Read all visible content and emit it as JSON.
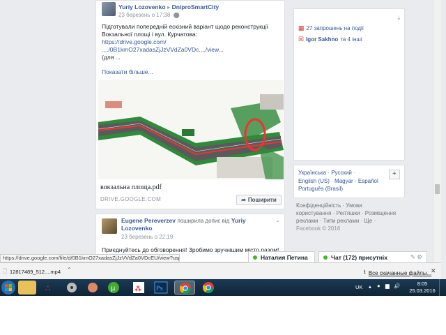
{
  "post1": {
    "author": "Yuriy Lozovenko",
    "arrow": "▸",
    "group": "DniproSmartCity",
    "time": "23 березень о 17:38",
    "globe": "·",
    "text_line1": "Підготували попередній ескізний варіант щодо реконструкції",
    "text_line2": "Вокзальної площі і вул. Курчатова:",
    "link_line1": "https://drive.google.com/",
    "link_line2": "..../0B1kmO27xadasZjJzVVdZa0VDc..../view...",
    "text_line3": "(для ...",
    "show_more": "Показати більше...",
    "attachment_title": "вокзальна площа.pdf",
    "attachment_domain": "DRIVE.GOOGLE.COM",
    "share_label": "Поширити"
  },
  "post2": {
    "author": "Eugene Pereverzev",
    "action": "поширила допис від",
    "author2": "Yuriy",
    "author2b": "Lozovenko",
    "time": "23 березень о 22:19",
    "text": "Приєднуйтесь до обговорення! Зробимо зручнішим місто разом!"
  },
  "right": {
    "invites": "27 запрошень на події",
    "person": "Igor Sakhno",
    "person_suffix": "та 4 інші"
  },
  "languages": {
    "row1": [
      "Українська",
      "Русский"
    ],
    "row2": [
      "English (US)",
      "Magyar",
      "Español"
    ],
    "row3": [
      "Português (Brasil)"
    ],
    "plus": "+"
  },
  "footer": {
    "line1": "Конфіденційність · Умови",
    "line2": "користування · Реп'яшки · Розміщення",
    "line3": "реклами · Типи реклами · Ще ·",
    "line4": "Facebook © 2016"
  },
  "chat": {
    "tab1": "Наталия Петина",
    "tab2": "Чат (172) присутніх"
  },
  "status_url": "https://drive.google.com/file/d/0B1kmO27xadasZjJzVVdZa0VDcEU/view?usp=sharing",
  "downloads": {
    "file": "12817489_512....mp4",
    "all": "Все скачанные файлы...",
    "close": "✕"
  },
  "taskbar": {
    "lang": "UK",
    "time": "8:05",
    "date": "25.03.2016"
  },
  "colors": {
    "fb_link": "#365899",
    "taskbar": "#0f2436",
    "chat_online": "#42b72a"
  }
}
